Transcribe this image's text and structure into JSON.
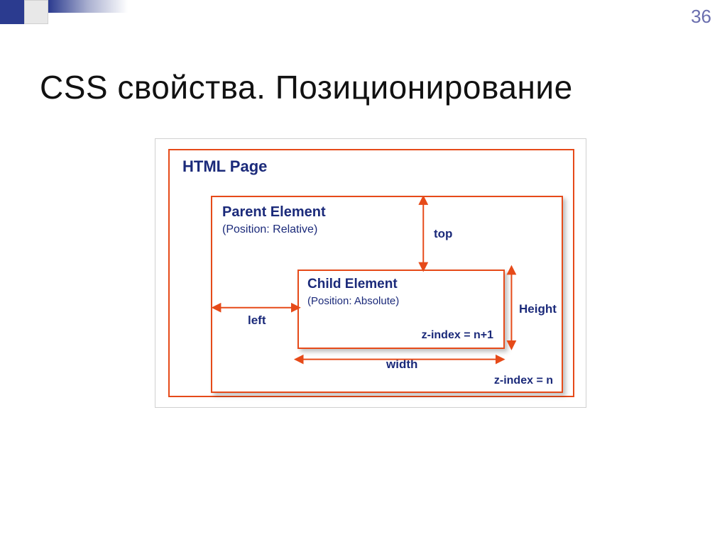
{
  "slide": {
    "number": "36"
  },
  "title": "CSS свойства. Позиционирование",
  "diagram": {
    "html_page": "HTML Page",
    "parent": {
      "title": "Parent Element",
      "sub": "(Position: Relative)",
      "zindex": "z-index = n"
    },
    "child": {
      "title": "Child Element",
      "sub": "(Position: Absolute)",
      "zindex": "z-index = n+1"
    },
    "dims": {
      "top": "top",
      "left": "left",
      "height": "Height",
      "width": "width"
    }
  }
}
